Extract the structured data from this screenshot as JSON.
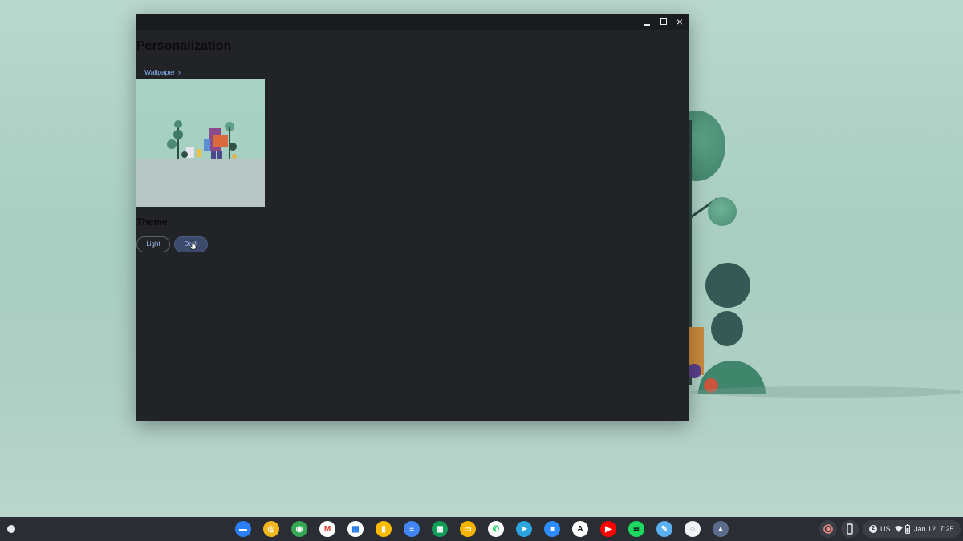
{
  "window": {
    "title": "Personalization",
    "breadcrumb": {
      "label": "Wallpaper",
      "chevron": "›"
    },
    "minimize_icon": "minimize-icon",
    "maximize_icon": "maximize-icon",
    "close_icon": "close-icon",
    "close_glyph": "×",
    "theme": {
      "title": "Theme",
      "options": [
        "Light",
        "Dark"
      ],
      "selected": "Dark"
    }
  },
  "shelf": {
    "apps": [
      {
        "name": "files-icon",
        "color": "#2d7ff9",
        "glyph": "▬"
      },
      {
        "name": "chrome-canary-icon",
        "color": "#f2b61f",
        "glyph": "◎"
      },
      {
        "name": "chrome-icon",
        "color": "#34a853",
        "glyph": "◉"
      },
      {
        "name": "gmail-icon",
        "color": "#ffffff",
        "glyph": "M",
        "fg": "#d93025"
      },
      {
        "name": "calendar-icon",
        "color": "#ffffff",
        "glyph": "▦",
        "fg": "#1a73e8"
      },
      {
        "name": "keep-icon",
        "color": "#fbbc04",
        "glyph": "▮"
      },
      {
        "name": "docs-icon",
        "color": "#4285f4",
        "glyph": "≡"
      },
      {
        "name": "sheets-icon",
        "color": "#0f9d58",
        "glyph": "▦"
      },
      {
        "name": "slides-icon",
        "color": "#f4b400",
        "glyph": "▭"
      },
      {
        "name": "whatsapp-icon",
        "color": "#ffffff",
        "glyph": "✆",
        "fg": "#25d366"
      },
      {
        "name": "telegram-icon",
        "color": "#2aa3de",
        "glyph": "➤"
      },
      {
        "name": "zoom-icon",
        "color": "#2d8cff",
        "glyph": "■"
      },
      {
        "name": "app-a-icon",
        "color": "#ffffff",
        "glyph": "A",
        "fg": "#111111"
      },
      {
        "name": "youtube-icon",
        "color": "#ff0000",
        "glyph": "▶"
      },
      {
        "name": "spotify-icon",
        "color": "#1ed760",
        "glyph": "≋",
        "fg": "#111111"
      },
      {
        "name": "app-p-icon",
        "color": "#5ab0f0",
        "glyph": "✎"
      },
      {
        "name": "app-circle-icon",
        "color": "#f1f3f4",
        "glyph": "◌",
        "fg": "#3c4043"
      },
      {
        "name": "personalization-app-icon",
        "color": "#5b6b8c",
        "glyph": "▲"
      }
    ],
    "tray": {
      "record_icon": "screen-record-icon",
      "phone_icon": "phone-hub-icon",
      "notification_count": "2",
      "input_method": "US",
      "wifi_icon": "wifi-icon",
      "battery_icon": "battery-icon",
      "datetime": "Jan 12, 7:25"
    }
  }
}
